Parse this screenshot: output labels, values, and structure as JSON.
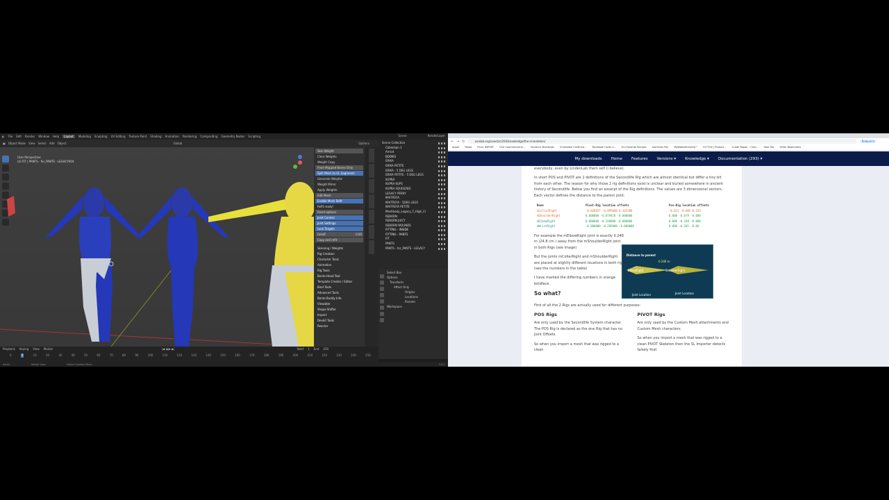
{
  "blender": {
    "menu": [
      "File",
      "Edit",
      "Render",
      "Window",
      "Help"
    ],
    "workspaces": [
      "Layout",
      "Modeling",
      "Sculpting",
      "UV Editing",
      "Texture Paint",
      "Shading",
      "Animation",
      "Rendering",
      "Compositing",
      "Geometry Nodes",
      "Scripting"
    ],
    "active_workspace": "Layout",
    "scene_label": "Scene",
    "view_layer_label": "RenderLayer",
    "header": [
      "Object Mode",
      "View",
      "Select",
      "Add",
      "Object"
    ],
    "global_label": "Global",
    "options_label": "Options",
    "viewport_label_1": "User Perspective",
    "viewport_label_2": "(4) FIT | PANTS - for_PANTS - LEGACY004",
    "side_panel": {
      "rows": [
        "Skin Weight",
        "Clear Weights",
        "Weight Copy",
        "From Mapped Bones Only",
        "Split Mesh to UL Segments",
        "Generate Weights",
        "Weight Mirror",
        "Apply Weights",
        "Edit Mesh",
        "Enable Mesh Refit",
        "Refit ready!",
        "Reset options",
        "Joint Control",
        "Joint Settings",
        "Lock Targets",
        "Falloff",
        "Copy and refit"
      ],
      "falloff_value": "0.00",
      "panels": [
        "Skinning / Weights",
        "Rig Creation",
        "Character Tools",
        "Animation",
        "Rig Tools",
        "Bento Head Tool",
        "Template Creator / Editor",
        "Bind Tools",
        "Advanced Tools",
        "Bento Buddy Info",
        "Viewable",
        "Shape Shifter",
        "Import",
        "Devkit Tools",
        "Reactor"
      ]
    },
    "outliner": {
      "header": "Scene Collection",
      "items": [
        "Collection 1",
        "Armat",
        "BODIES",
        "ERIKA",
        "ERIKA PETITE",
        "ERIKA - 5 DEG LEGS",
        "ERIKA PETITE - 5 DEG LEGS",
        "KUPRA",
        "KUPRA KUPS",
        "KUPRA SQUEEZED",
        "LEGACY PERKY",
        "MAITREYA",
        "MAITREYA - 5DEG LEGS",
        "MAITREYA PETITE",
        "Meshbody_Legacy_F_High_Cl",
        "REBORN",
        "REBORN JUICY",
        "REBORN WOUNDS",
        "FITTING - INSIDE",
        "FITTING - PANTS",
        "FIT",
        "PANTS",
        "PANTS - for_PANTS - LEGACY"
      ],
      "highlighted": [
        "Collection 1",
        "BODIES",
        "FITTING - INSIDE",
        "FITTING - PANTS",
        "FIT"
      ]
    },
    "props": [
      "Select Box",
      "Options",
      "Transform",
      "Affect Only",
      "Origins",
      "Locations",
      "Parents",
      "Workspace"
    ],
    "timeline_head": [
      "Playback",
      "Keying",
      "View",
      "Marker"
    ],
    "timeline_start_label": "Start",
    "timeline_start": "1",
    "timeline_end_label": "End",
    "timeline_end": "250",
    "current_frame": "4",
    "ruler": [
      "0",
      "10",
      "20",
      "30",
      "40",
      "50",
      "60",
      "70",
      "80",
      "90",
      "100",
      "110",
      "120",
      "130",
      "140",
      "150",
      "160",
      "170",
      "180",
      "190",
      "200",
      "210",
      "220",
      "230",
      "240",
      "250"
    ],
    "status": [
      "Select",
      "Rotate View",
      "Object Context Menu",
      "3.6.1"
    ]
  },
  "browser": {
    "url": "avalab.org/avastar/293/knowledge/the-sl-skeleton/",
    "relaunch": "Relaunch",
    "bookmarks": [
      "Apple",
      "Yahoo",
      "Flickr IMPORT",
      "CSU Commenceme...",
      "Dynamic Dividends",
      "Chickadee Confirma...",
      "Facebook Cover v...",
      "Our Favorite Recipes",
      "Seminars Pay",
      "MyWebsiteUnited™",
      "E27700 | Product...",
      "Credit Repair - Cred...",
      "Take Tab",
      "Other Bookmarks"
    ],
    "nav": [
      "My downloads",
      "Home",
      "Features",
      "Versions ▾",
      "Knowledge ▾",
      "Documentation (293) ▾"
    ]
  },
  "article": {
    "p0": "everybody, even by LindenLab them self (i believe).",
    "p1": "In short POS and PIVOT are 2 definitions of the Secondlife Rig which are almost identical but differ a tiny bit from each other. The reason for why those 2 rig definitions exist is unclear and buried somewhere in ancient history of Secondlife. Below you find an excerpt of the Rig definitions. The values are 3 dimensional vectors. Each vector defines the distance to the parent joint:",
    "table": {
      "headers": [
        "Bone",
        "Pivot-Rig location offsets",
        "Pos-Rig location offsets"
      ],
      "rows": [
        {
          "bone": "mCollarRight",
          "pivot": "-0.020927 -0.095000  0.165396",
          "pos": "-0.021 -0.085 0.165"
        },
        {
          "bone": "mShoulderRight",
          "pivot": " 0.000000 -0.079418 -0.000000",
          "pos": " 0.000 -0.079 -0.000"
        },
        {
          "bone": "mElbowRight",
          "pivot": " 0.000000 -0.248000 -0.000000",
          "pos": " 0.000 -0.248 -0.000"
        },
        {
          "bone": "mWristRight",
          "pivot": "-0.000000 -0.205000 -0.000000",
          "pos": " 0.000 -0.205 -0.00"
        }
      ]
    },
    "p2": "For example the mElbowRight joint is exactly 0.248 m (24.8 cm ) away from the mShoulderRight joint in both Rigs (see image)",
    "p3": "But the joints mCollarRight and mShoulderRight are placed at slightly different locations in both rigs (see the numbers in the table)",
    "p4": "I have marked the differing numbers in orange boldface.",
    "diagram": {
      "distance": "Distance to parent",
      "measure": "0.248 m",
      "elbow": "ElbowRight",
      "shoulder": "ShoulderRight",
      "joint": "Joint Location"
    },
    "so_what": "So what?",
    "p5": "First of all the 2 Rigs are actually used for different purposes:",
    "pos_h": "POS Rigs",
    "pos_p1": "Are only used by the Secondlife System character. The POS Rig is declared as the one Rig that has no Joint Offsets.",
    "pos_p2": "So when you import a mesh that was rigged to a clean",
    "pivot_h": "PIVOT Rigs",
    "pivot_p1": "Are only used by the Custom Mesh attachments and Custom Mesh characters.",
    "pivot_p2": "So when you import a mesh that was rigged to a clean PIVOT Skeleton then the SL Importer detects falsely that"
  }
}
